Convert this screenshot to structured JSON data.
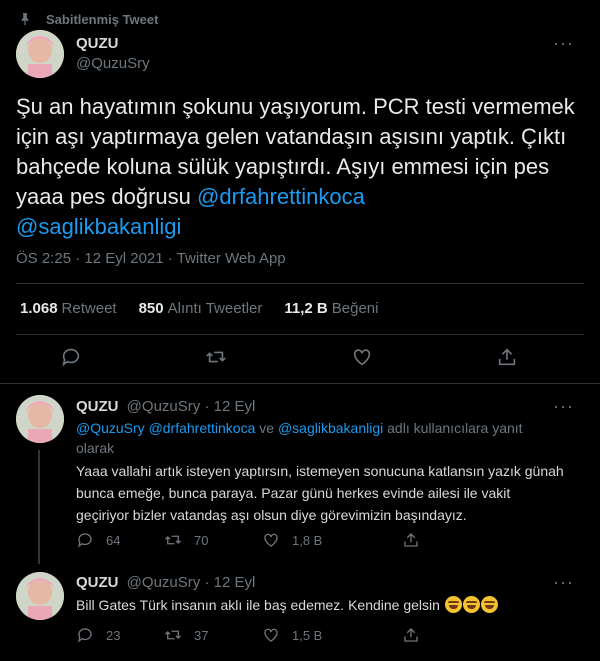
{
  "pinned_label": "Sabitlenmiş Tweet",
  "main_tweet": {
    "name": "QUZU",
    "handle": "@QuzuSry",
    "text_plain": "Şu an hayatımın şokunu yaşıyorum. PCR testi vermemek için aşı yaptırmaya gelen vatandaşın aşısını yaptık. Çıktı bahçede koluna sülük yapıştırdı. Aşıyı emmesi için pes yaaa pes doğrusu ",
    "mention_1": "@drfahrettinkoca",
    "mention_2": "@saglikbakanligi",
    "time": "ÖS 2:25",
    "date": "12 Eyl 2021",
    "source": "Twitter Web App",
    "retweets_count": "1.068",
    "retweets_label": "Retweet",
    "quotes_count": "850",
    "quotes_label": "Alıntı Tweetler",
    "likes_count": "11,2 B",
    "likes_label": "Beğeni"
  },
  "replies": [
    {
      "name": "QUZU",
      "handle": "@QuzuSry",
      "date": "12 Eyl",
      "reply_to_mentions": "@QuzuSry @drfahrettinkoca",
      "reply_to_and": "ve",
      "reply_to_mention_last": "@saglikbakanligi",
      "reply_to_suffix": "adlı kullanıcılara yanıt olarak",
      "text": "Yaaa vallahi artık isteyen yaptırsın, istemeyen sonucuna katlansın yazık günah bunca emeğe, bunca paraya. Pazar günü herkes evinde ailesi ile vakit geçiriyor bizler vatandaş aşı olsun diye görevimizin başındayız.",
      "replies": "64",
      "retweets": "70",
      "likes": "1,8 B"
    },
    {
      "name": "QUZU",
      "handle": "@QuzuSry",
      "date": "12 Eyl",
      "text": "Bill Gates Türk insanın aklı ile baş edemez. Kendine gelsin",
      "emoji": "😂😂😂",
      "replies": "23",
      "retweets": "37",
      "likes": "1,5 B"
    }
  ],
  "colors": {
    "background": "#000000",
    "link": "#1d9bf0",
    "muted": "#6e767d",
    "divider": "#2f3336"
  }
}
